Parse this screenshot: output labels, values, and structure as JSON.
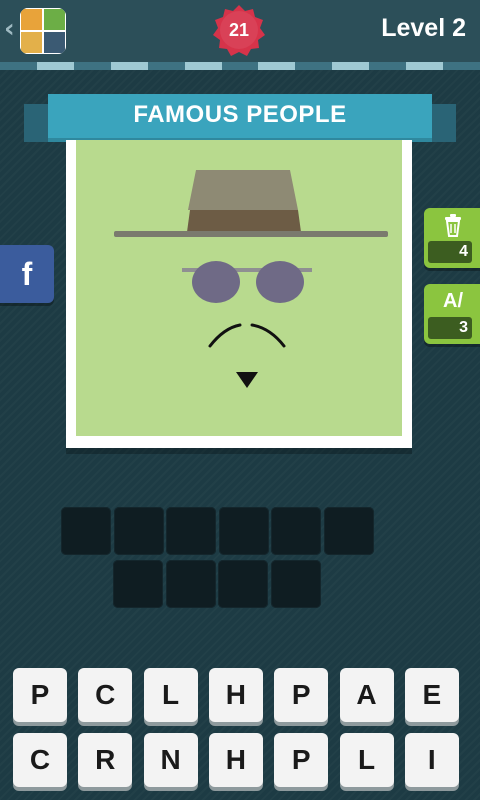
{
  "header": {
    "back_icon": "chevron-left-icon",
    "app_icon": "game-logo-icon",
    "coins": "21",
    "coin_color": "#d6334a",
    "level": "Level 2"
  },
  "category": {
    "title": "FAMOUS PEOPLE",
    "ribbon_color": "#3aa4bd"
  },
  "puzzle": {
    "image_icon": "hat-sunglasses-mustache-icon",
    "answer_length_row1": 6,
    "answer_length_row2": 4
  },
  "side_buttons": {
    "facebook": {
      "label": "f",
      "color": "#3b5c9d"
    },
    "hints": [
      {
        "icon": "trash-can-icon",
        "icon_text": "🗑",
        "count": "4",
        "color": "#8bc53f"
      },
      {
        "icon": "reveal-letter-icon",
        "icon_text": "A/",
        "count": "3",
        "color": "#8bc53f"
      }
    ]
  },
  "keyboard": {
    "row1": [
      "P",
      "C",
      "L",
      "H",
      "P",
      "A",
      "E"
    ],
    "row2": [
      "C",
      "R",
      "N",
      "H",
      "P",
      "L",
      "I"
    ]
  }
}
